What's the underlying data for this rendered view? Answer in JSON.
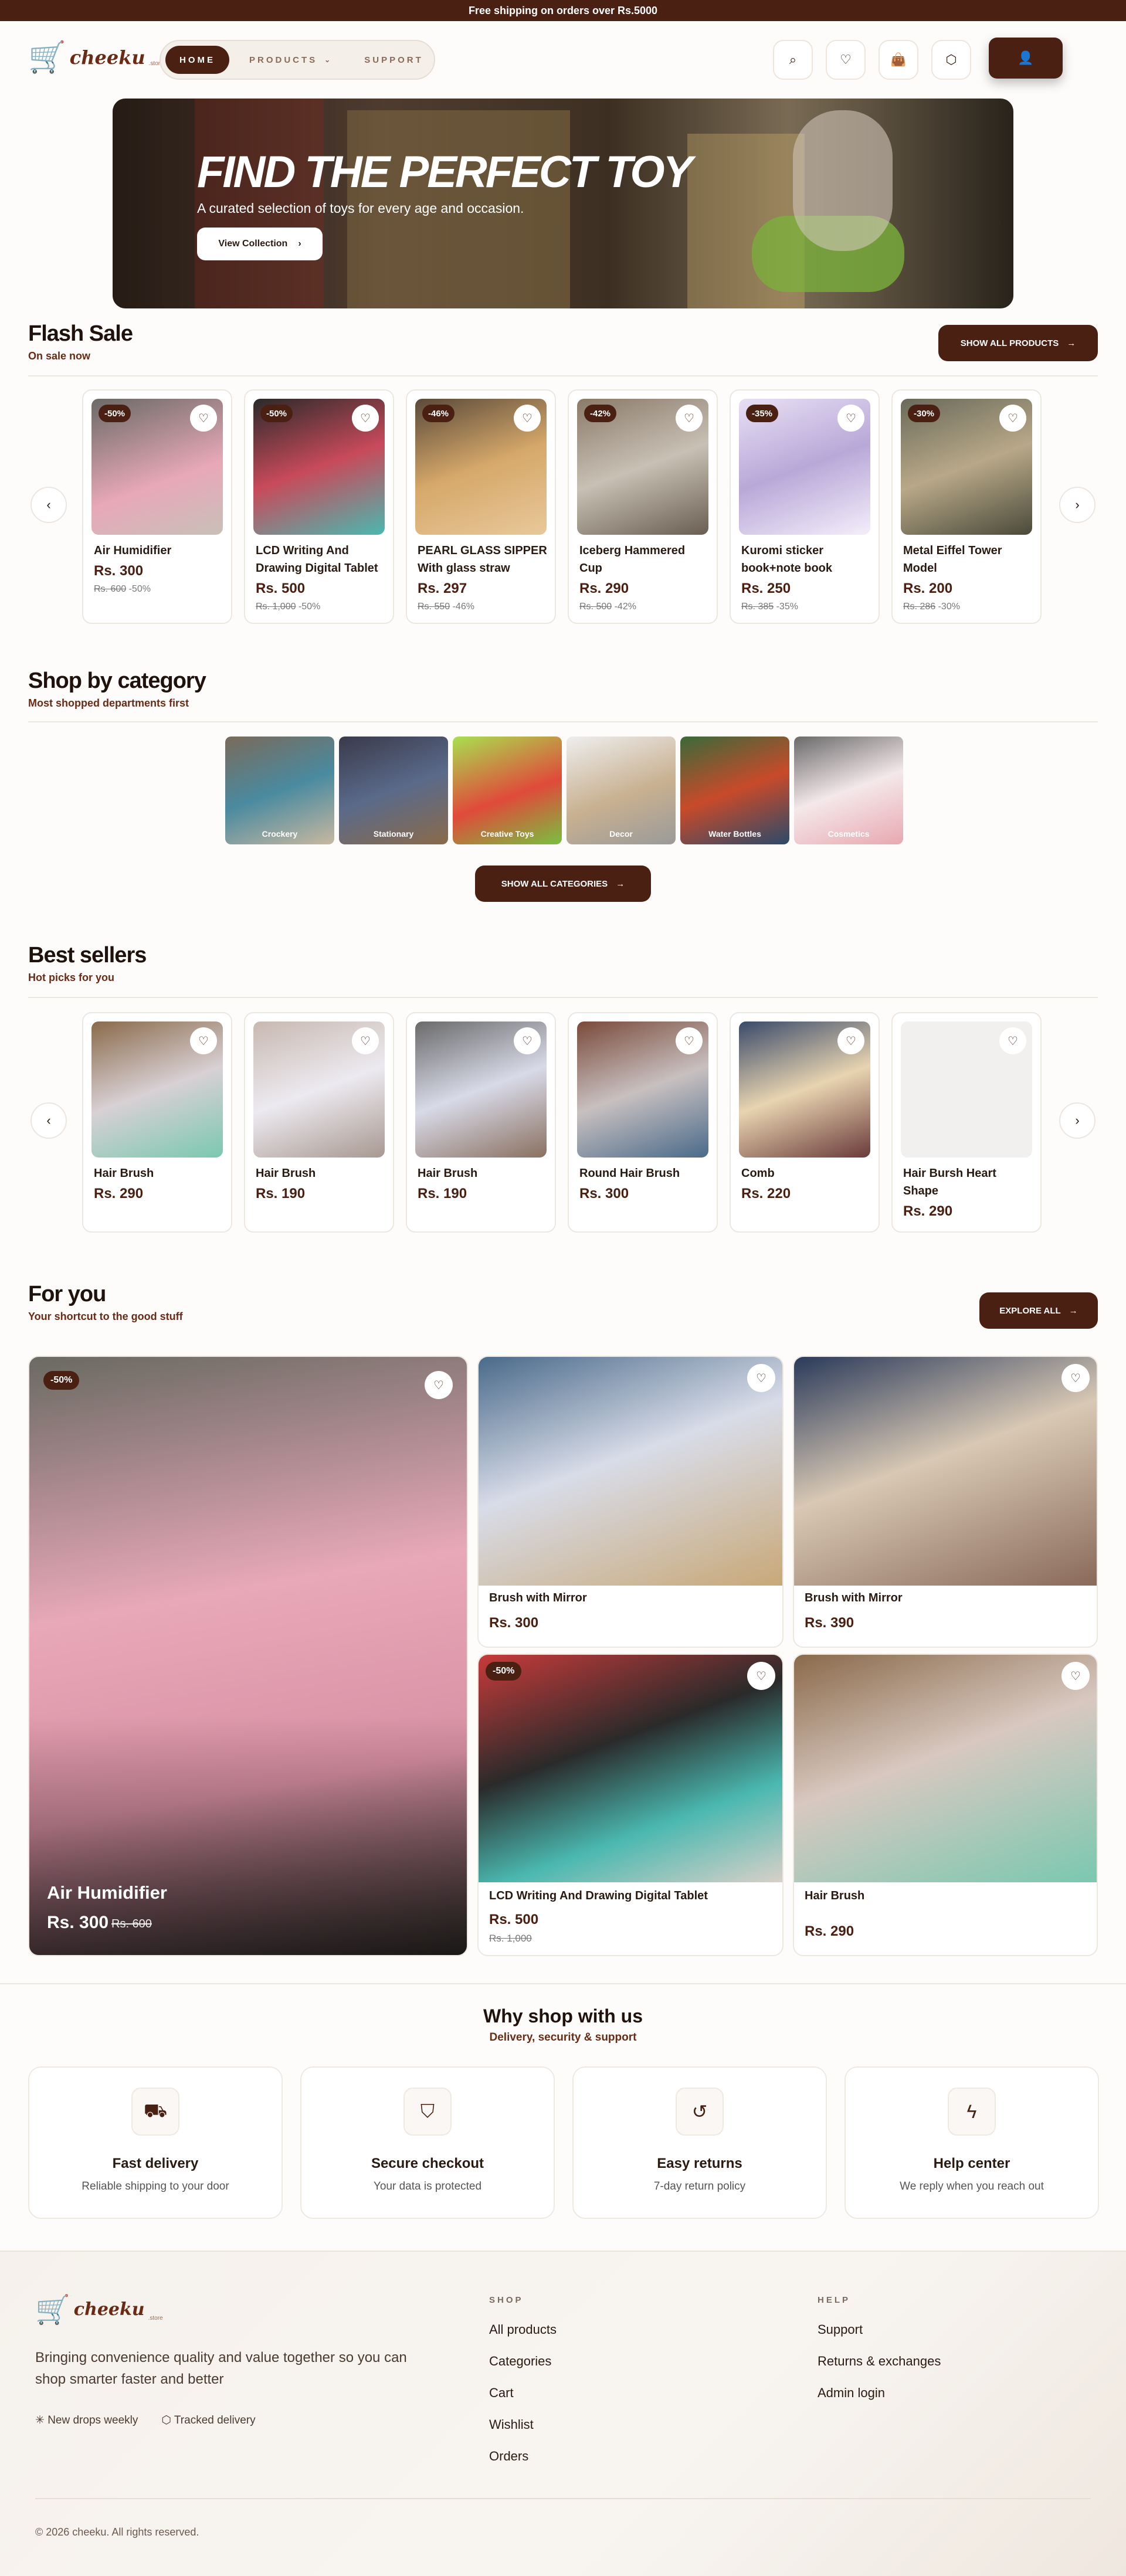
{
  "promo": {
    "text": "Free shipping on orders over Rs.5000"
  },
  "brand": {
    "name": "cheeku",
    "suffix": ".store"
  },
  "nav": {
    "items": [
      "HOME",
      "PRODUCTS",
      "SUPPORT"
    ]
  },
  "hero": {
    "title": "FIND THE PERFECT TOY",
    "subtitle": "A curated selection of toys for every age and occasion.",
    "button": "View Collection"
  },
  "flash": {
    "title": "Flash Sale",
    "subtitle": "On sale now",
    "button": "SHOW ALL PRODUCTS",
    "items": [
      {
        "name": "Air Humidifier",
        "price": "Rs. 300",
        "old": "Rs. 600",
        "off": "-50%",
        "badge": "-50%"
      },
      {
        "name": "LCD Writing And Drawing Digital Tablet",
        "price": "Rs. 500",
        "old": "Rs. 1,000",
        "off": "-50%",
        "badge": "-50%"
      },
      {
        "name": "PEARL GLASS SIPPER With glass straw",
        "price": "Rs. 297",
        "old": "Rs. 550",
        "off": "-46%",
        "badge": "-46%"
      },
      {
        "name": "Iceberg Hammered Cup",
        "price": "Rs. 290",
        "old": "Rs. 500",
        "off": "-42%",
        "badge": "-42%"
      },
      {
        "name": "Kuromi sticker book+note book",
        "price": "Rs. 250",
        "old": "Rs. 385",
        "off": "-35%",
        "badge": "-35%"
      },
      {
        "name": "Metal Eiffel Tower Model",
        "price": "Rs. 200",
        "old": "Rs. 286",
        "off": "-30%",
        "badge": "-30%"
      }
    ]
  },
  "category": {
    "title": "Shop by category",
    "subtitle": "Most shopped departments first",
    "button": "SHOW ALL CATEGORIES",
    "items": [
      "Crockery",
      "Stationary",
      "Creative Toys",
      "Decor",
      "Water Bottles",
      "Cosmetics"
    ]
  },
  "best": {
    "title": "Best sellers",
    "subtitle": "Hot picks for you",
    "items": [
      {
        "name": "Hair Brush",
        "price": "Rs. 290"
      },
      {
        "name": "Hair Brush",
        "price": "Rs. 190"
      },
      {
        "name": "Hair Brush",
        "price": "Rs. 190"
      },
      {
        "name": "Round Hair Brush",
        "price": "Rs. 300"
      },
      {
        "name": "Comb",
        "price": "Rs. 220"
      },
      {
        "name": "Hair Bursh Heart Shape",
        "price": "Rs. 290"
      }
    ]
  },
  "foryou": {
    "title": "For you",
    "subtitle": "Your shortcut to the good stuff",
    "button": "EXPLORE ALL",
    "featured": {
      "name": "Air Humidifier",
      "price": "Rs. 300",
      "old": "Rs. 600",
      "badge": "-50%"
    },
    "items": [
      {
        "name": "Brush with Mirror",
        "price": "Rs. 300"
      },
      {
        "name": "Brush with Mirror",
        "price": "Rs. 390"
      },
      {
        "name": "LCD Writing And Drawing Digital Tablet",
        "price": "Rs. 500",
        "old": "Rs. 1,000",
        "badge": "-50%"
      },
      {
        "name": "Hair Brush",
        "price": "Rs. 290"
      }
    ]
  },
  "why": {
    "title": "Why shop with us",
    "subtitle": "Delivery, security & support",
    "items": [
      {
        "title": "Fast delivery",
        "text": "Reliable shipping to your door",
        "icon": "truck-icon"
      },
      {
        "title": "Secure checkout",
        "text": "Your data is protected",
        "icon": "shield-icon"
      },
      {
        "title": "Easy returns",
        "text": "7-day return policy",
        "icon": "return-icon"
      },
      {
        "title": "Help center",
        "text": "We reply when you reach out",
        "icon": "bolt-icon"
      }
    ]
  },
  "footer": {
    "tagline": "Bringing convenience quality and value together so you can shop smarter faster and better",
    "chips": [
      "New drops weekly",
      "Tracked delivery"
    ],
    "shop_title": "SHOP",
    "shop": [
      "All products",
      "Categories",
      "Cart",
      "Wishlist",
      "Orders"
    ],
    "help_title": "HELP",
    "help": [
      "Support",
      "Returns & exchanges",
      "Admin login"
    ],
    "copyright": "© 2026 cheeku. All rights reserved."
  },
  "colors": {
    "brand": "#4a2012",
    "accent": "#6b2a14",
    "background": "#fdfcfa"
  }
}
